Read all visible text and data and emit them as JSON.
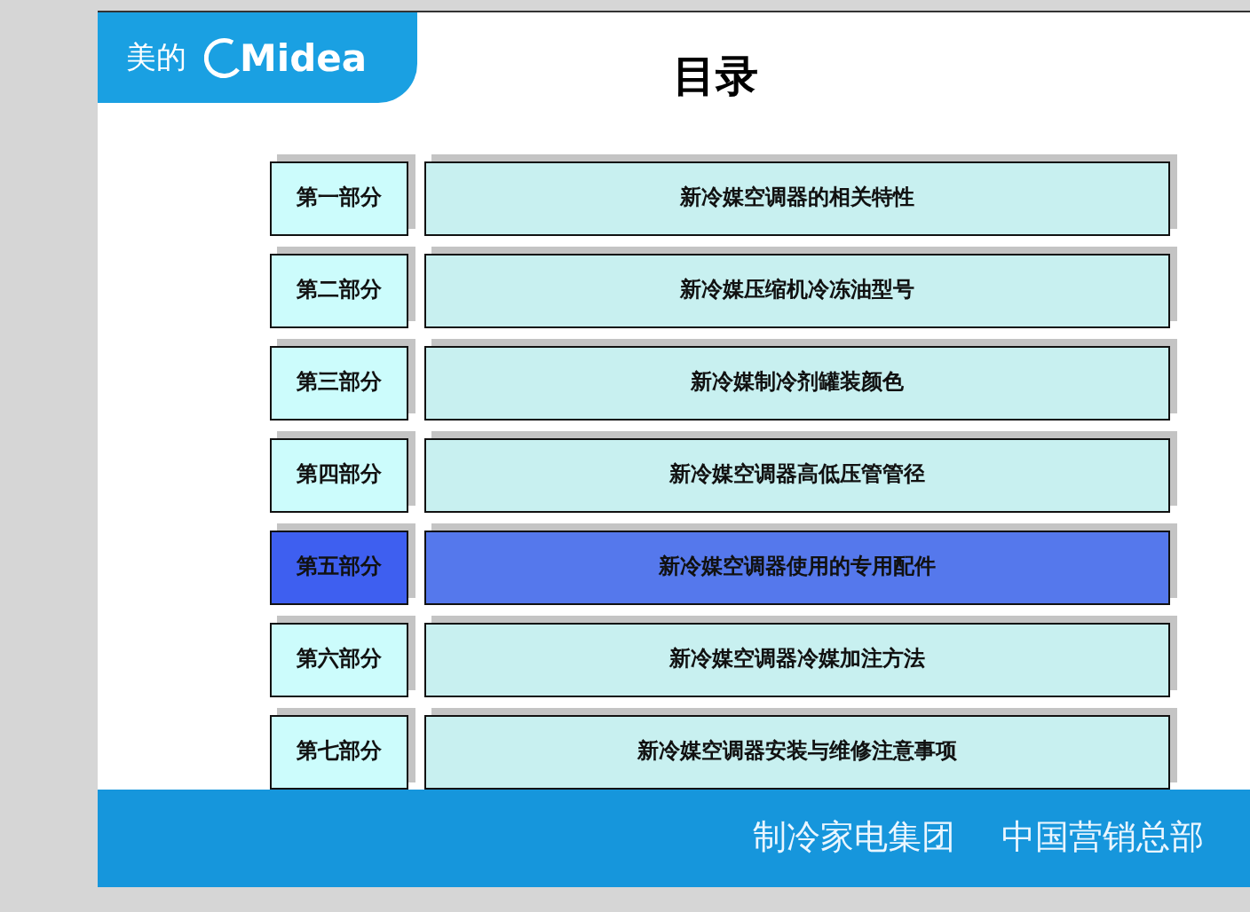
{
  "logo": {
    "name_cn": "美的",
    "name_en": "Midea"
  },
  "title": "目录",
  "sections": [
    {
      "part": "第一部分",
      "heading": "新冷媒空调器的相关特性",
      "selected": false
    },
    {
      "part": "第二部分",
      "heading": "新冷媒压缩机冷冻油型号",
      "selected": false
    },
    {
      "part": "第三部分",
      "heading": "新冷媒制冷剂罐装颜色",
      "selected": false
    },
    {
      "part": "第四部分",
      "heading": "新冷媒空调器高低压管管径",
      "selected": false
    },
    {
      "part": "第五部分",
      "heading": "新冷媒空调器使用的专用配件",
      "selected": true
    },
    {
      "part": "第六部分",
      "heading": "新冷媒空调器冷媒加注方法",
      "selected": false
    },
    {
      "part": "第七部分",
      "heading": "新冷媒空调器安装与维修注意事项",
      "selected": false
    }
  ],
  "footer": [
    "制冷家电集团",
    "中国营销总部"
  ]
}
